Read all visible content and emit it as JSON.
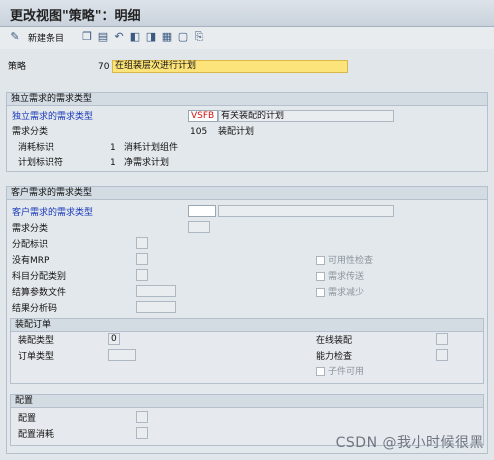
{
  "window": {
    "title": "更改视图\"策略\"：明细"
  },
  "toolbar": {
    "new_entries_label": "新建条目",
    "icons": [
      "glasses-icon",
      "copy-icon",
      "delete-icon",
      "undo-icon",
      "nav-prev-icon",
      "nav-next-icon",
      "select-all-icon",
      "deselect-icon"
    ]
  },
  "strategy": {
    "label": "策略",
    "code": "70",
    "description": "在组装层次进行计划"
  },
  "independent": {
    "header": "独立需求的需求类型",
    "req_type_label": "独立需求的需求类型",
    "req_type_code": "VSFB",
    "req_type_text": "有关装配的计划",
    "req_class_label": "需求分类",
    "req_class_code": "105",
    "req_class_text": "装配计划",
    "consumption_label": "消耗标识",
    "consumption_code": "1",
    "consumption_text": "消耗计划组件",
    "planning_label": "计划标识符",
    "planning_code": "1",
    "planning_text": "净需求计划"
  },
  "customer": {
    "header": "客户需求的需求类型",
    "req_type_label": "客户需求的需求类型",
    "req_class_label": "需求分类",
    "allocation_label": "分配标识",
    "no_mrp_label": "没有MRP",
    "acct_assign_label": "科目分配类别",
    "settlement_profile_label": "结算参数文件",
    "results_analysis_label": "结果分析码",
    "availability_check_label": "可用性检查",
    "req_transfer_label": "需求传送",
    "req_reduction_label": "需求减少"
  },
  "assembly": {
    "header": "装配订单",
    "type_label": "装配类型",
    "type_value": "0",
    "order_type_label": "订单类型",
    "online_assembly_label": "在线装配",
    "capacity_check_label": "能力检查",
    "components_avail_label": "子件可用"
  },
  "config": {
    "header": "配置",
    "config_label": "配置",
    "config_consumption_label": "配置消耗"
  },
  "watermark": "CSDN @我小时候很黑"
}
